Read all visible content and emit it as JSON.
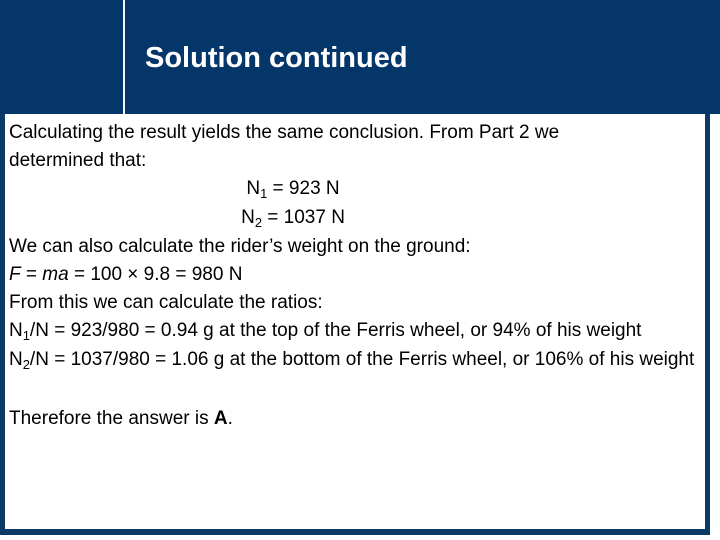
{
  "slide": {
    "title": "Solution continued",
    "theme": {
      "header_background": "#05366a",
      "header_divider": "#f2f5f8",
      "content_border": "#0b3a68",
      "content_background": "#ffffff",
      "title_color": "#ffffff",
      "body_text_color": "#000000"
    }
  },
  "body": {
    "intro_line_1": "Calculating the result yields the same conclusion. From Part 2 we",
    "intro_line_2": "determined that:",
    "eq_n1": {
      "symbol": "N",
      "subscript": "1",
      "rest": " = 923 N"
    },
    "eq_n2": {
      "symbol": "N",
      "subscript": "2",
      "rest": " = 1037 N"
    },
    "weight_intro": "We can also calculate the rider’s weight on the ground:",
    "force_equation": {
      "f": "F",
      "eq1": " = ",
      "ma": "ma",
      "rest": " = 100 × 9.8 = 980 N"
    },
    "ratios_intro": "From this we can calculate the ratios:",
    "ratio_1": {
      "symbol": "N",
      "subscript": "1",
      "rest": "/N = 923/980 = 0.94 g at the top of the Ferris wheel, or 94% of his weight"
    },
    "ratio_2": {
      "symbol": "N",
      "subscript": "2",
      "rest": "/N = 1037/980 = 1.06 g at the bottom of the Ferris wheel, or 106% of his weight"
    },
    "conclusion": {
      "prefix": "Therefore the answer is ",
      "answer": "A",
      "suffix": "."
    }
  }
}
